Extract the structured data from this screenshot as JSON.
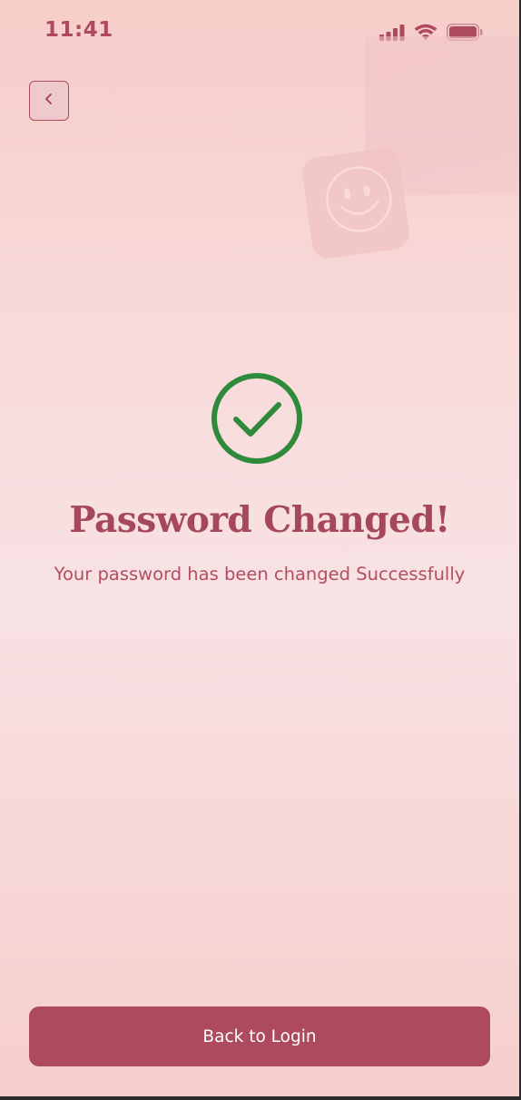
{
  "status_bar": {
    "time": "11:41",
    "icons": [
      "cellular-signal-icon",
      "wifi-icon",
      "battery-icon"
    ]
  },
  "header": {
    "back_icon": "chevron-left-icon"
  },
  "decorations": [
    "background-photo",
    "smiley-face-icon"
  ],
  "main": {
    "icon": "check-circle-icon",
    "title": "Password Changed!",
    "subtitle": "Your password has been changed Successfully"
  },
  "footer": {
    "button_label": "Back to Login"
  },
  "colors": {
    "accent": "#ad4a5d",
    "success": "#2f8a3b",
    "background_top": "#f6cdc9",
    "background_mid": "#f8e2e4"
  }
}
